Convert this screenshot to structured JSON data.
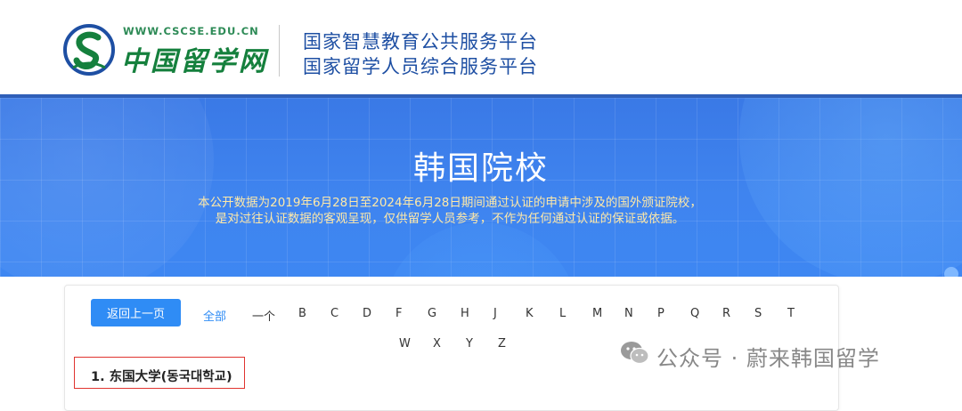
{
  "header": {
    "logo_url": "WWW.CSCSE.EDU.CN",
    "logo_name": "中国留学网",
    "platform_line1": "国家智慧教育公共服务平台",
    "platform_line2": "国家留学人员综合服务平台"
  },
  "banner": {
    "title": "韩国院校",
    "desc_line1": "本公开数据为2019年6月28日至2024年6月28日期间通过认证的申请中涉及的国外颁证院校，",
    "desc_line2": "是对过往认证数据的客观呈现，仅供留学人员参考，不作为任何通过认证的保证或依据。"
  },
  "filter": {
    "back_label": "返回上一页",
    "all_label": "全部",
    "letters_row1": [
      "一个",
      "B",
      "C",
      "D",
      "F",
      "G",
      "H",
      "J",
      "K",
      "L",
      "M",
      "N",
      "P",
      "Q",
      "R",
      "S",
      "T"
    ],
    "letters_row2": [
      "W",
      "X",
      "Y",
      "Z"
    ]
  },
  "schools": [
    {
      "label": "1. 东国大学(동국대학교)"
    }
  ],
  "watermark": {
    "text": "公众号 · 蔚来韩国留学"
  },
  "colors": {
    "banner_blue": "#3e84ee",
    "accent_blue": "#2f8cf5",
    "title_navy": "#1e4fa3",
    "logo_green": "#15803d",
    "desc_yellow": "#ffe9a8",
    "highlight_red": "#e0342f"
  }
}
